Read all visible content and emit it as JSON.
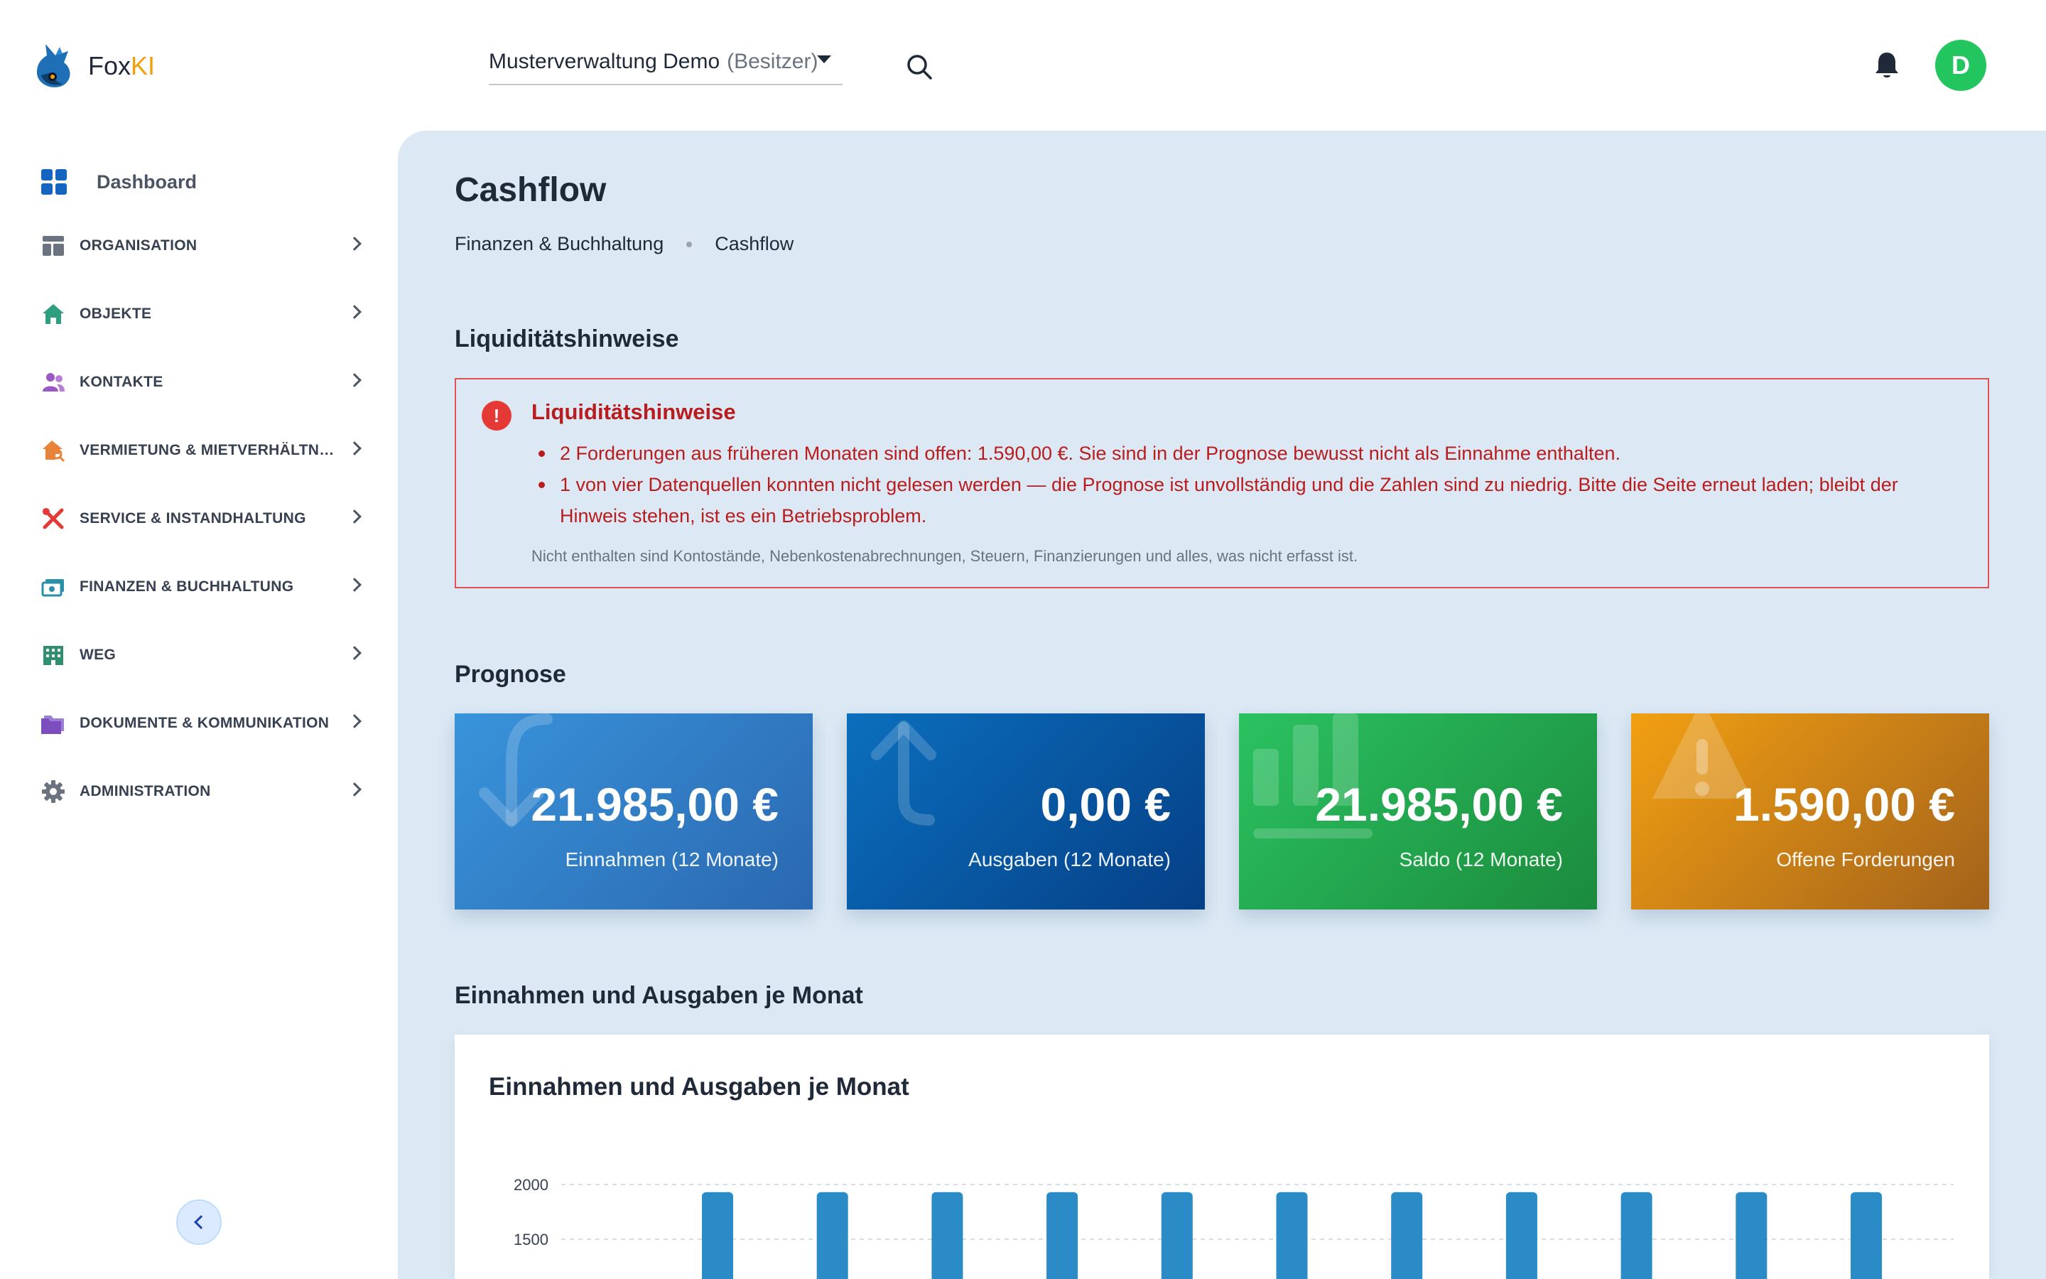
{
  "app": {
    "brand_main": "Fox",
    "brand_accent": "KI",
    "accent_color": "#f59e0b"
  },
  "header": {
    "tenant_name": "Musterverwaltung Demo",
    "tenant_role": "(Besitzer)",
    "avatar_initial": "D",
    "avatar_color": "#22c55e"
  },
  "sidebar": {
    "dashboard_label": "Dashboard",
    "items": [
      {
        "label": "ORGANISATION",
        "icon": "layout-icon",
        "color": "#6b7280"
      },
      {
        "label": "OBJEKTE",
        "icon": "house-icon",
        "color": "#2f9e7e"
      },
      {
        "label": "KONTAKTE",
        "icon": "users-icon",
        "color": "#9b59c6"
      },
      {
        "label": "VERMIETUNG & MIETVERHÄLTNISSE",
        "icon": "home-search-icon",
        "color": "#e8833a"
      },
      {
        "label": "SERVICE & INSTANDHALTUNG",
        "icon": "tools-icon",
        "color": "#e53935"
      },
      {
        "label": "FINANZEN & BUCHHALTUNG",
        "icon": "money-icon",
        "color": "#2a8fa8"
      },
      {
        "label": "WEG",
        "icon": "building-icon",
        "color": "#2f8f6e"
      },
      {
        "label": "DOKUMENTE & KOMMUNIKATION",
        "icon": "folder-icon",
        "color": "#7c4dbd"
      },
      {
        "label": "ADMINISTRATION",
        "icon": "gear-icon",
        "color": "#6b7280"
      }
    ]
  },
  "page": {
    "title": "Cashflow",
    "breadcrumb": [
      "Finanzen & Buchhaltung",
      "Cashflow"
    ]
  },
  "alert": {
    "section_title": "Liquiditätshinweise",
    "title": "Liquiditätshinweise",
    "items": [
      "2 Forderungen aus früheren Monaten sind offen: 1.590,00 €. Sie sind in der Prognose bewusst nicht als Einnahme enthalten.",
      "1 von vier Datenquellen konnten nicht gelesen werden — die Prognose ist unvollständig und die Zahlen sind zu niedrig. Bitte die Seite erneut laden; bleibt der Hinweis stehen, ist es ein Betriebsproblem."
    ],
    "note": "Nicht enthalten sind Kontostände, Nebenkostenabrechnungen, Steuern, Finanzierungen und alles, was nicht erfasst ist."
  },
  "forecast": {
    "section_title": "Prognose",
    "cards": [
      {
        "value": "21.985,00 €",
        "label": "Einnahmen (12 Monate)",
        "icon": "arrow-down-icon"
      },
      {
        "value": "0,00 €",
        "label": "Ausgaben (12 Monate)",
        "icon": "arrow-up-icon"
      },
      {
        "value": "21.985,00 €",
        "label": "Saldo (12 Monate)",
        "icon": "bar-chart-icon"
      },
      {
        "value": "1.590,00 €",
        "label": "Offene Forderungen",
        "icon": "warning-icon"
      }
    ]
  },
  "monthly": {
    "section_title": "Einnahmen und Ausgaben je Monat"
  },
  "chart_data": {
    "type": "bar",
    "title": "Einnahmen und Ausgaben je Monat",
    "ylim": [
      0,
      2000
    ],
    "yticks": [
      1500,
      2000
    ],
    "grid": true,
    "series": [
      {
        "values": [
          1930,
          1930,
          1930,
          1930,
          1930,
          1930,
          1930,
          1930,
          1930,
          1930,
          1930
        ],
        "color": "#2b8bc6"
      }
    ]
  }
}
